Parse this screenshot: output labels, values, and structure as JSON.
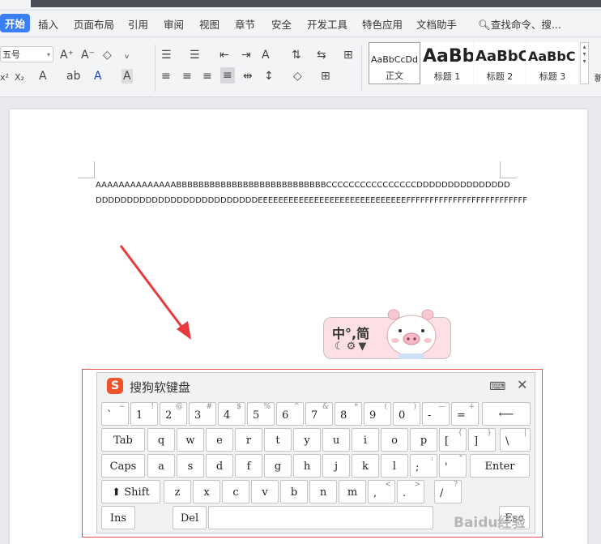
{
  "tabs": [
    {
      "label": "开始",
      "active": true
    },
    {
      "label": "插入"
    },
    {
      "label": "页面布局"
    },
    {
      "label": "引用"
    },
    {
      "label": "审阅"
    },
    {
      "label": "视图"
    },
    {
      "label": "章节"
    },
    {
      "label": "安全"
    },
    {
      "label": "开发工具"
    },
    {
      "label": "特色应用"
    },
    {
      "label": "文档助手"
    }
  ],
  "search": {
    "label": "查找命令、搜..."
  },
  "ribbon": {
    "font_size": "五号",
    "styles": [
      {
        "sample": "AaBbCcDd",
        "name": "正文"
      },
      {
        "sample": "AaBb",
        "name": "标题 1"
      },
      {
        "sample": "AaBbC",
        "name": "标题 2"
      },
      {
        "sample": "AaBbC",
        "name": "标题 3"
      }
    ],
    "extra": "新"
  },
  "document": {
    "line1": "AAAAAAAAAAAAAABBBBBBBBBBBBBBBBBBBBBBBBBBBCCCCCCCCCCCCCCCCDDDDDDDDDDDDDDD",
    "line2": "DDDDDDDDDDDDDDDDDDDDDDDDDDEEEEEEEEEEEEEEEEEEEEEEEEEEEEEFFFFFFFFFFFFFFFFFFFFFFFFFF"
  },
  "ime": {
    "status": "中°,简"
  },
  "keyboard": {
    "title": "搜狗软键盘",
    "rows": [
      [
        {
          "k": "`",
          "s": "~"
        },
        {
          "k": "1",
          "s": "!"
        },
        {
          "k": "2",
          "s": "@"
        },
        {
          "k": "3",
          "s": "#"
        },
        {
          "k": "4",
          "s": "$"
        },
        {
          "k": "5",
          "s": "%"
        },
        {
          "k": "6",
          "s": "^"
        },
        {
          "k": "7",
          "s": "&"
        },
        {
          "k": "8",
          "s": "*"
        },
        {
          "k": "9",
          "s": "("
        },
        {
          "k": "0",
          "s": ")"
        },
        {
          "k": "-",
          "s": "—"
        },
        {
          "k": "=",
          "s": "+"
        },
        {
          "k": "⟵",
          "s": ""
        }
      ],
      [
        {
          "k": "Tab",
          "s": ""
        },
        {
          "k": "q",
          "s": ""
        },
        {
          "k": "w",
          "s": ""
        },
        {
          "k": "e",
          "s": ""
        },
        {
          "k": "r",
          "s": ""
        },
        {
          "k": "t",
          "s": ""
        },
        {
          "k": "y",
          "s": ""
        },
        {
          "k": "u",
          "s": ""
        },
        {
          "k": "i",
          "s": ""
        },
        {
          "k": "o",
          "s": ""
        },
        {
          "k": "p",
          "s": ""
        },
        {
          "k": "[",
          "s": "{"
        },
        {
          "k": "]",
          "s": "}"
        },
        {
          "k": "\\",
          "s": "|"
        }
      ],
      [
        {
          "k": "Caps",
          "s": ""
        },
        {
          "k": "a",
          "s": ""
        },
        {
          "k": "s",
          "s": ""
        },
        {
          "k": "d",
          "s": ""
        },
        {
          "k": "f",
          "s": ""
        },
        {
          "k": "g",
          "s": ""
        },
        {
          "k": "h",
          "s": ""
        },
        {
          "k": "j",
          "s": ""
        },
        {
          "k": "k",
          "s": ""
        },
        {
          "k": "l",
          "s": ""
        },
        {
          "k": ";",
          "s": ":"
        },
        {
          "k": "'",
          "s": "\""
        },
        {
          "k": "Enter",
          "s": ""
        }
      ],
      [
        {
          "k": "⬆ Shift",
          "s": ""
        },
        {
          "k": "z",
          "s": ""
        },
        {
          "k": "x",
          "s": ""
        },
        {
          "k": "c",
          "s": ""
        },
        {
          "k": "v",
          "s": ""
        },
        {
          "k": "b",
          "s": ""
        },
        {
          "k": "n",
          "s": ""
        },
        {
          "k": "m",
          "s": ""
        },
        {
          "k": ",",
          "s": "<"
        },
        {
          "k": ".",
          "s": ">"
        },
        {
          "k": "/",
          "s": "?"
        }
      ],
      [
        {
          "k": "Ins",
          "s": ""
        },
        {
          "k": "Del",
          "s": ""
        },
        {
          "k": "",
          "s": ""
        },
        {
          "k": "Esc",
          "s": ""
        }
      ]
    ]
  },
  "watermark": "Baidu经验"
}
